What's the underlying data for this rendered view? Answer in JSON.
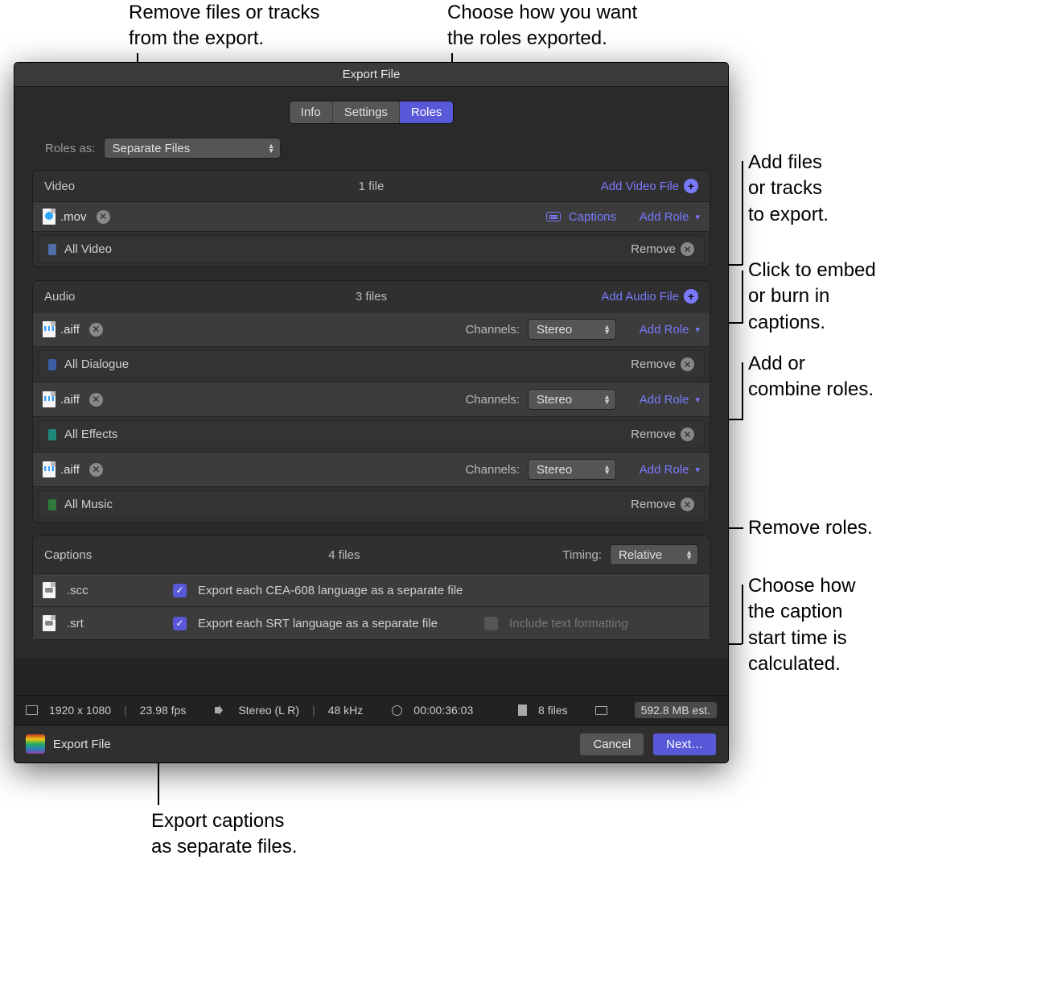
{
  "callouts": {
    "top_left": "Remove files or tracks\nfrom the export.",
    "top_right": "Choose how you want\nthe roles exported.",
    "r1": "Add files\nor tracks\nto export.",
    "r2": "Click to embed\nor burn in\ncaptions.",
    "r3": "Add or\ncombine roles.",
    "r4": "Remove roles.",
    "r5": "Choose how\nthe caption\nstart time is\ncalculated.",
    "bottom": "Export captions\nas separate files."
  },
  "window": {
    "title": "Export File",
    "tabs": {
      "info": "Info",
      "settings": "Settings",
      "roles": "Roles"
    },
    "roles_as_label": "Roles as:",
    "roles_as_value": "Separate Files",
    "video": {
      "title": "Video",
      "count": "1 file",
      "add_label": "Add Video File",
      "file": {
        "ext": ".mov",
        "captions_label": "Captions",
        "add_role": "Add Role"
      },
      "role": {
        "swatch": "#4e6ea8",
        "name": "All Video",
        "remove": "Remove"
      }
    },
    "audio": {
      "title": "Audio",
      "count": "3 files",
      "add_label": "Add Audio File",
      "channels_label": "Channels:",
      "add_role": "Add Role",
      "remove": "Remove",
      "files": [
        {
          "ext": ".aiff",
          "channels": "Stereo",
          "role_swatch": "#3a5fa6",
          "role_name": "All Dialogue"
        },
        {
          "ext": ".aiff",
          "channels": "Stereo",
          "role_swatch": "#1e887a",
          "role_name": "All Effects"
        },
        {
          "ext": ".aiff",
          "channels": "Stereo",
          "role_swatch": "#2e7a3a",
          "role_name": "All Music"
        }
      ]
    },
    "captions": {
      "title": "Captions",
      "count": "4 files",
      "timing_label": "Timing:",
      "timing_value": "Relative",
      "rows": [
        {
          "ext": ".scc",
          "check": true,
          "label": "Export each CEA-608 language as a separate file",
          "extra_check": null,
          "extra_label": null
        },
        {
          "ext": ".srt",
          "check": true,
          "label": "Export each SRT language as a separate file",
          "extra_check": false,
          "extra_label": "Include text formatting"
        }
      ]
    },
    "status": {
      "resolution": "1920 x 1080",
      "fps": "23.98 fps",
      "audio": "Stereo (L R)",
      "rate": "48 kHz",
      "duration": "00:00:36:03",
      "files": "8 files",
      "size": "592.8 MB est."
    },
    "bottom": {
      "title": "Export File",
      "cancel": "Cancel",
      "next": "Next…"
    }
  }
}
